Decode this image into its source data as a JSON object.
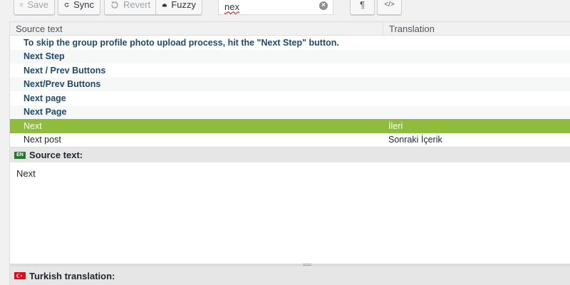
{
  "toolbar": {
    "save_label": "Save",
    "sync_label": "Sync",
    "revert_label": "Revert",
    "fuzzy_label": "Fuzzy",
    "search_value": "nex",
    "paragraph_label": "¶",
    "code_label": "</>"
  },
  "table": {
    "headers": {
      "source": "Source text",
      "translation": "Translation"
    },
    "rows": [
      {
        "source": "To skip the group profile photo upload process, hit the \"Next Step\" button.",
        "translation": ""
      },
      {
        "source": "Next Step",
        "translation": ""
      },
      {
        "source": "Next / Prev Buttons",
        "translation": ""
      },
      {
        "source": "Next/Prev Buttons",
        "translation": ""
      },
      {
        "source": "Next page",
        "translation": ""
      },
      {
        "source": "Next Page",
        "translation": ""
      },
      {
        "source": "Next",
        "translation": "İleri"
      },
      {
        "source": "Next post",
        "translation": "Sonraki İçerik"
      }
    ]
  },
  "source_panel": {
    "flag": "EN",
    "title": "Source text:",
    "content": "Next"
  },
  "translation_panel": {
    "title": "Turkish translation:"
  },
  "colors": {
    "selected_row": "#8fbc3a",
    "source_text": "#1f4a6f"
  }
}
